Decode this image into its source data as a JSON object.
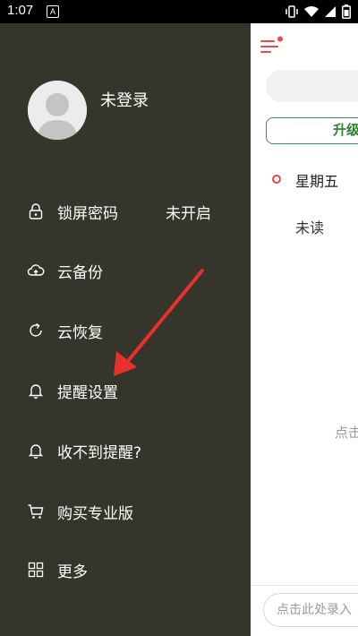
{
  "status_bar": {
    "time": "1:07",
    "notification_letter": "A",
    "icons": [
      "vibrate-icon",
      "wifi-icon",
      "signal-icon",
      "battery-icon"
    ]
  },
  "drawer": {
    "user": {
      "name": "未登录",
      "avatar": "default-avatar"
    },
    "items": [
      {
        "label": "锁屏密码",
        "value": "未开启",
        "icon": "lock-icon"
      },
      {
        "label": "云备份",
        "icon": "cloud-upload-icon"
      },
      {
        "label": "云恢复",
        "icon": "refresh-icon"
      },
      {
        "label": "提醒设置",
        "icon": "bell-icon"
      },
      {
        "label": "收不到提醒?",
        "icon": "bell-icon"
      },
      {
        "label": "购买专业版",
        "icon": "cart-icon"
      },
      {
        "label": "更多",
        "icon": "grid-icon"
      }
    ]
  },
  "background_app": {
    "upgrade_label": "升级",
    "day_label": "星期五",
    "unread_label": "未读",
    "hint_text": "点击",
    "input_placeholder": "点击此处录入"
  },
  "colors": {
    "drawer_bg": "#35352b",
    "accent_red": "#e84a4a",
    "accent_green": "#2e7d32"
  }
}
